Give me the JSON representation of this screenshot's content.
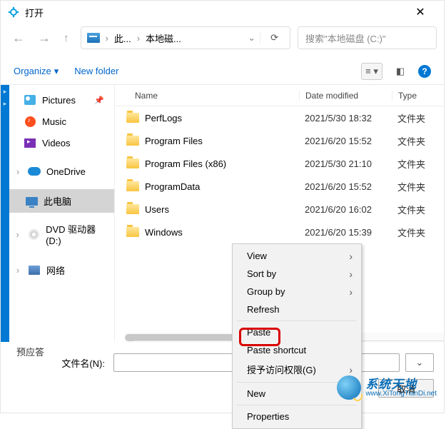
{
  "window": {
    "title": "打开"
  },
  "breadcrumb": {
    "part1": "此...",
    "part2": "本地磁..."
  },
  "search": {
    "placeholder": "搜索\"本地磁盘 (C:)\""
  },
  "toolbar": {
    "organize": "Organize",
    "new_folder": "New folder"
  },
  "sidebar": {
    "pictures": "Pictures",
    "music": "Music",
    "videos": "Videos",
    "onedrive": "OneDrive",
    "this_pc": "此电脑",
    "dvd": "DVD 驱动器 (D:)",
    "network": "网络"
  },
  "columns": {
    "name": "Name",
    "date": "Date modified",
    "type": "Type"
  },
  "files": [
    {
      "name": "PerfLogs",
      "date": "2021/5/30 18:32",
      "type": "文件夹"
    },
    {
      "name": "Program Files",
      "date": "2021/6/20 15:52",
      "type": "文件夹"
    },
    {
      "name": "Program Files (x86)",
      "date": "2021/5/30 21:10",
      "type": "文件夹"
    },
    {
      "name": "ProgramData",
      "date": "2021/6/20 15:52",
      "type": "文件夹"
    },
    {
      "name": "Users",
      "date": "2021/6/20 16:02",
      "type": "文件夹"
    },
    {
      "name": "Windows",
      "date": "2021/6/20 15:39",
      "type": "文件夹"
    }
  ],
  "filename": {
    "label": "文件名(N):"
  },
  "buttons": {
    "cancel": "取消"
  },
  "context_menu": {
    "view": "View",
    "sort_by": "Sort by",
    "group_by": "Group by",
    "refresh": "Refresh",
    "paste": "Paste",
    "paste_shortcut": "Paste shortcut",
    "grant_access": "授予访问权限(G)",
    "new": "New",
    "properties": "Properties"
  },
  "bottom_label": "预应答",
  "watermark": {
    "line1": "系统天地",
    "line2": "www.XiTongTianDi.net"
  }
}
